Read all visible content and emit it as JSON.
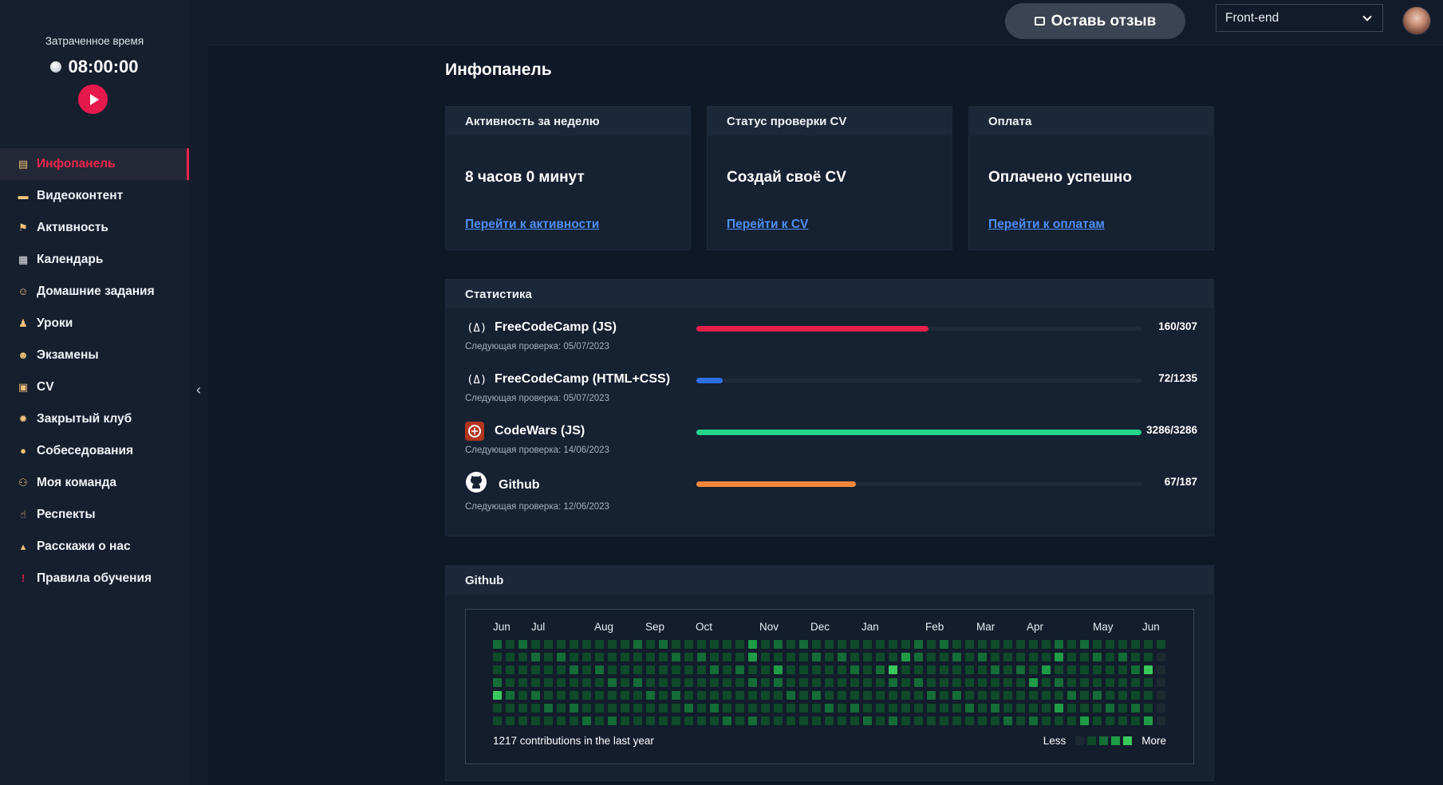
{
  "sidebar": {
    "time_caption": "Затраченное время",
    "time_value": "08:00:00",
    "items": [
      {
        "label": "Инфопанель",
        "icon": "chart-icon"
      },
      {
        "label": "Видеоконтент",
        "icon": "video-icon"
      },
      {
        "label": "Активность",
        "icon": "runner-icon"
      },
      {
        "label": "Календарь",
        "icon": "calendar-icon"
      },
      {
        "label": "Домашние задания",
        "icon": "homework-icon"
      },
      {
        "label": "Уроки",
        "icon": "lesson-icon"
      },
      {
        "label": "Экзамены",
        "icon": "exam-icon"
      },
      {
        "label": "CV",
        "icon": "briefcase-icon"
      },
      {
        "label": "Закрытый клуб",
        "icon": "club-icon"
      },
      {
        "label": "Собеседования",
        "icon": "interview-icon"
      },
      {
        "label": "Моя команда",
        "icon": "team-icon"
      },
      {
        "label": "Респекты",
        "icon": "thumbs-up-icon"
      },
      {
        "label": "Расскажи о нас",
        "icon": "money-bag-icon"
      },
      {
        "label": "Правила обучения",
        "icon": "exclamation-icon"
      }
    ]
  },
  "header": {
    "feedback_label": "Оставь отзыв",
    "track_value": "Front-end"
  },
  "main": {
    "title": "Инфопанель",
    "cards": [
      {
        "title": "Активность за неделю",
        "value": "8 часов 0 минут",
        "link": "Перейти к активности"
      },
      {
        "title": "Статус проверки CV",
        "value": "Создай своё CV",
        "link": "Перейти к CV"
      },
      {
        "title": "Оплата",
        "value": "Оплачено успешно",
        "link": "Перейти к оплатам"
      }
    ],
    "stats": {
      "title": "Статистика",
      "rows": [
        {
          "name": "FreeCodeCamp (JS)",
          "sub": "Следующая проверка: 05/07/2023",
          "count": "160/307",
          "done": 160,
          "total": 307,
          "color": "#e8204a",
          "icon": "freecodecamp-icon"
        },
        {
          "name": "FreeCodeCamp (HTML+CSS)",
          "sub": "Следующая проверка: 05/07/2023",
          "count": "72/1235",
          "done": 72,
          "total": 1235,
          "color": "#2f6fe4",
          "icon": "freecodecamp-icon"
        },
        {
          "name": "CodeWars (JS)",
          "sub": "Следующая проверка: 14/06/2023",
          "count": "3286/3286",
          "done": 3286,
          "total": 3286,
          "color": "#22d68a",
          "icon": "codewars-icon"
        },
        {
          "name": "Github",
          "sub": "Следующая проверка: 12/06/2023",
          "count": "67/187",
          "done": 67,
          "total": 187,
          "color": "#f0873a",
          "icon": "github-icon"
        }
      ]
    },
    "github": {
      "title": "Github",
      "months": [
        "Jun",
        "Jul",
        "Aug",
        "Sep",
        "Oct",
        "Nov",
        "Dec",
        "Jan",
        "Feb",
        "Mar",
        "Apr",
        "May",
        "Jun"
      ],
      "total_text": "1217 contributions in the last year",
      "legend_less": "Less",
      "legend_more": "More",
      "palette": [
        "#1d2a32",
        "#0f4a2a",
        "#146c36",
        "#1f9c46",
        "#39c85a"
      ]
    }
  }
}
